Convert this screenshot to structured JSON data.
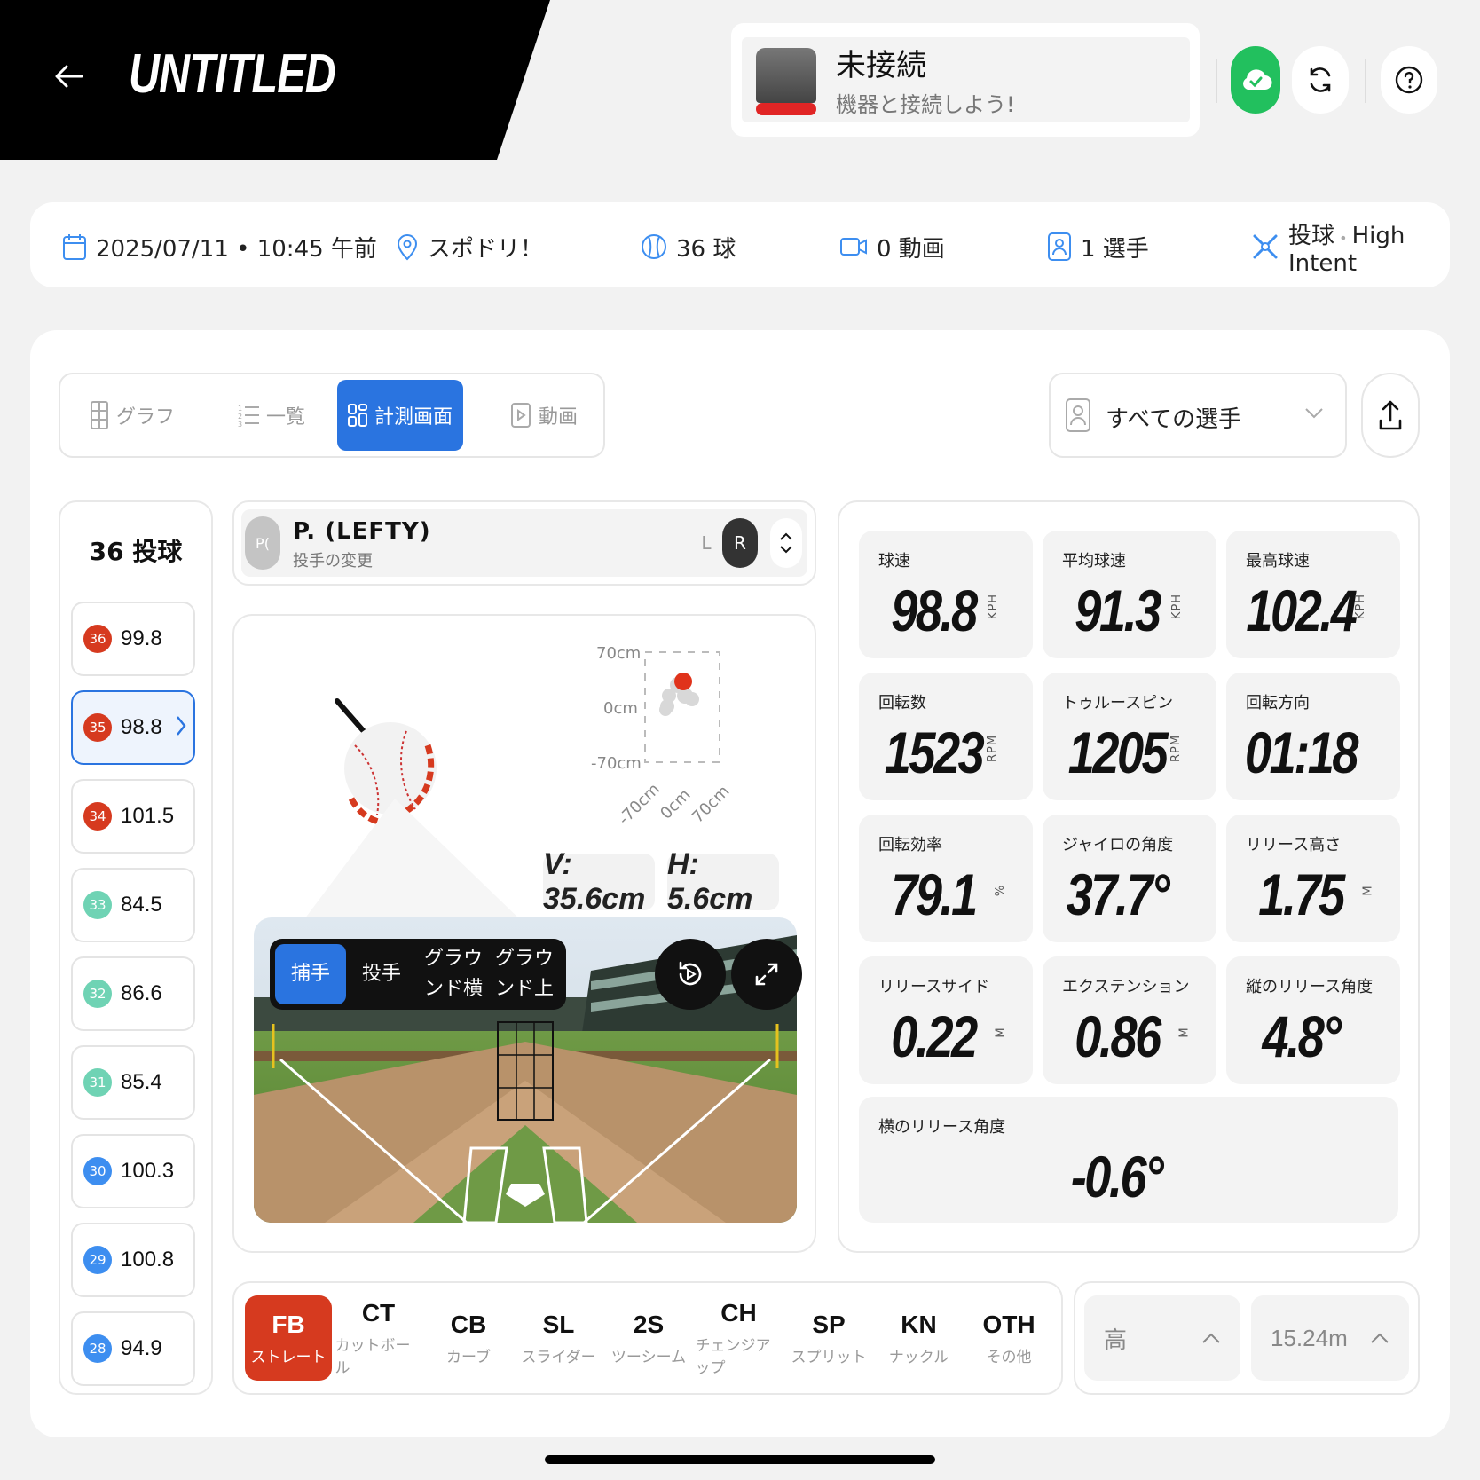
{
  "header": {
    "title": "UNTITLED",
    "back_icon": "arrow-left-icon",
    "connection": {
      "status": "未接続",
      "message": "機器と接続しよう!"
    }
  },
  "info": {
    "date": "2025/07/11 • 10:45 午前",
    "location": "スポドリ！",
    "balls": "36 球",
    "videos": "0 動画",
    "players": "1 選手",
    "mode_label": "投球",
    "mode_sep": " • ",
    "intent": "High Intent"
  },
  "tabs": [
    {
      "label": "グラフ",
      "icon": "chart-icon"
    },
    {
      "label": "一覧",
      "icon": "list-icon"
    },
    {
      "label": "計測画面",
      "icon": "dashboard-icon"
    },
    {
      "label": "動画",
      "icon": "video-icon"
    }
  ],
  "player_filter": "すべての選手",
  "list": {
    "title": "36 投球",
    "items": [
      {
        "num": "36",
        "value": "99.8",
        "color": "#d63a1f"
      },
      {
        "num": "35",
        "value": "98.8",
        "color": "#d63a1f"
      },
      {
        "num": "34",
        "value": "101.5",
        "color": "#d63a1f"
      },
      {
        "num": "33",
        "value": "84.5",
        "color": "#6fd3b4"
      },
      {
        "num": "32",
        "value": "86.6",
        "color": "#6fd3b4"
      },
      {
        "num": "31",
        "value": "85.4",
        "color": "#6fd3b4"
      },
      {
        "num": "30",
        "value": "100.3",
        "color": "#3d8ef0"
      },
      {
        "num": "29",
        "value": "100.8",
        "color": "#3d8ef0"
      },
      {
        "num": "28",
        "value": "94.9",
        "color": "#3d8ef0"
      }
    ]
  },
  "player": {
    "avatar": "P(",
    "name": "P. (LEFTY)",
    "sub": "投手の変更",
    "hand_l": "L",
    "hand_r": "R"
  },
  "zone": {
    "y_top": "70cm",
    "y_mid": "0cm",
    "y_bot": "-70cm",
    "x_left": "-70cm",
    "x_mid": "0cm",
    "x_right": "70cm",
    "v": "V: 35.6cm",
    "h": "H: 5.6cm"
  },
  "views": {
    "catcher": "捕手",
    "pitcher": "投手",
    "side_1": "グラウ",
    "side_2": "ンド横",
    "top_1": "グラウ",
    "top_2": "ンド上"
  },
  "metrics": [
    {
      "label": "球速",
      "value": "98.8",
      "unit": "KPH"
    },
    {
      "label": "平均球速",
      "value": "91.3",
      "unit": "KPH"
    },
    {
      "label": "最高球速",
      "value": "102.4",
      "unit": "KPH"
    },
    {
      "label": "回転数",
      "value": "1523",
      "unit": "RPM"
    },
    {
      "label": "トゥルースピン",
      "value": "1205",
      "unit": "RPM"
    },
    {
      "label": "回転方向",
      "value": "01:18",
      "unit": ""
    },
    {
      "label": "回転効率",
      "value": "79.1",
      "unit": "%"
    },
    {
      "label": "ジャイロの角度",
      "value": "37.7°",
      "unit": ""
    },
    {
      "label": "リリース高さ",
      "value": "1.75",
      "unit": "M"
    },
    {
      "label": "リリースサイド",
      "value": "0.22",
      "unit": "M"
    },
    {
      "label": "エクステンション",
      "value": "0.86",
      "unit": "M"
    },
    {
      "label": "縦のリリース角度",
      "value": "4.8°",
      "unit": ""
    },
    {
      "label": "横のリリース角度",
      "value": "-0.6°",
      "unit": ""
    }
  ],
  "pitch_types": [
    {
      "code": "FB",
      "name": "ストレート"
    },
    {
      "code": "CT",
      "name": "カットボール"
    },
    {
      "code": "CB",
      "name": "カーブ"
    },
    {
      "code": "SL",
      "name": "スライダー"
    },
    {
      "code": "2S",
      "name": "ツーシーム"
    },
    {
      "code": "CH",
      "name": "チェンジアップ"
    },
    {
      "code": "SP",
      "name": "スプリット"
    },
    {
      "code": "KN",
      "name": "ナックル"
    },
    {
      "code": "OTH",
      "name": "その他"
    }
  ],
  "height": {
    "label": "高",
    "distance": "15.24m"
  },
  "colors": {
    "accent": "#2a74e0",
    "fastball": "#d63a1f",
    "connected": "#22c05e",
    "disconnected": "#e12525"
  }
}
